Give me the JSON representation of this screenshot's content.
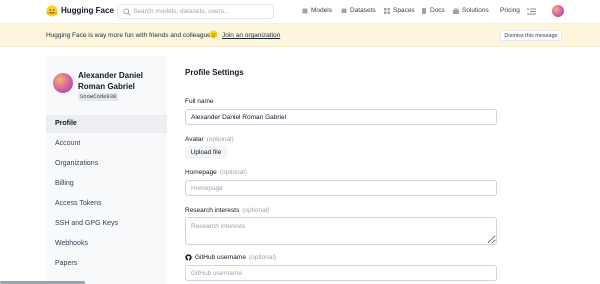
{
  "topnav": {
    "brand": "Hugging Face",
    "search_placeholder": "Search models, datasets, users...",
    "items": [
      {
        "label": "Models",
        "icon": "cube-icon"
      },
      {
        "label": "Datasets",
        "icon": "database-icon"
      },
      {
        "label": "Spaces",
        "icon": "grid-icon"
      },
      {
        "label": "Docs",
        "icon": "docs-icon"
      },
      {
        "label": "Solutions",
        "icon": "briefcase-icon"
      },
      {
        "label": "Pricing",
        "icon": ""
      }
    ]
  },
  "banner": {
    "text": "Hugging Face is way more fun with friends and colleagues!",
    "link": "Join an organization",
    "dismiss": "Dismiss this message"
  },
  "profile": {
    "name": "Alexander Daniel Roman Gabriel",
    "handle": "SnowCode938"
  },
  "sidebar": {
    "items": [
      {
        "label": "Profile",
        "active": true
      },
      {
        "label": "Account"
      },
      {
        "label": "Organizations"
      },
      {
        "label": "Billing"
      },
      {
        "label": "Access Tokens"
      },
      {
        "label": "SSH and GPG Keys"
      },
      {
        "label": "Webhooks"
      },
      {
        "label": "Papers"
      }
    ]
  },
  "main": {
    "title": "Profile Settings",
    "full_name": {
      "label": "Full name",
      "value": "Alexander Daniel Roman Gabriel"
    },
    "avatar": {
      "label": "Avatar",
      "optional": "(optional)",
      "button": "Upload file"
    },
    "homepage": {
      "label": "Homepage",
      "optional": "(optional)",
      "placeholder": "Homepage"
    },
    "research": {
      "label": "Research interests",
      "optional": "(optional)",
      "placeholder": "Research interests"
    },
    "github": {
      "label": "GitHub username",
      "optional": "(optional)",
      "placeholder": "GitHub username"
    }
  }
}
